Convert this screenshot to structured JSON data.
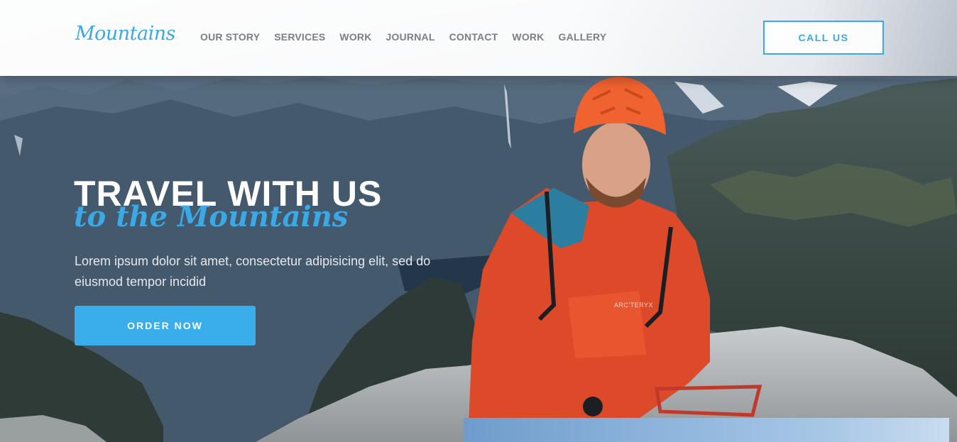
{
  "brand": {
    "logo_text": "Mountains",
    "accent_color": "#3aa9e6"
  },
  "nav": {
    "items": [
      {
        "label": "OUR STORY"
      },
      {
        "label": "SERVICES"
      },
      {
        "label": "WORK"
      },
      {
        "label": "JOURNAL"
      },
      {
        "label": "CONTACT"
      },
      {
        "label": "WORK"
      },
      {
        "label": "GALLERY"
      }
    ],
    "cta_label": "CALL US"
  },
  "hero": {
    "title": "TRAVEL WITH US",
    "subtitle": "to the Mountains",
    "description": "Lorem ipsum dolor sit amet, consectetur adipisicing elit, sed do eiusmod tempor incidid",
    "order_button_label": "ORDER NOW",
    "jacket_brand": "ARC'TERYX"
  }
}
